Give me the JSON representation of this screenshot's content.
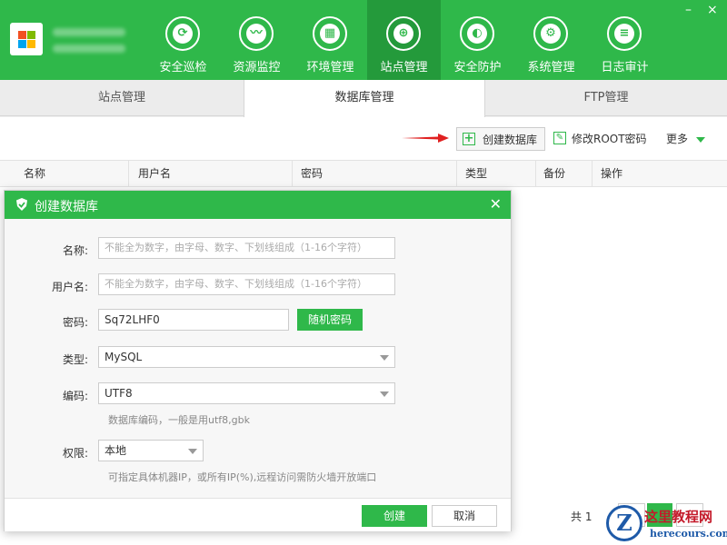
{
  "header": {
    "nav": [
      {
        "label": "安全巡检",
        "icon": "scan-icon",
        "glyph": "⟳"
      },
      {
        "label": "资源监控",
        "icon": "monitor-icon",
        "glyph": "〰"
      },
      {
        "label": "环境管理",
        "icon": "server-icon",
        "glyph": "▦"
      },
      {
        "label": "站点管理",
        "icon": "globe-icon",
        "glyph": "⊕"
      },
      {
        "label": "安全防护",
        "icon": "shield-icon",
        "glyph": "◐"
      },
      {
        "label": "系统管理",
        "icon": "settings-icon",
        "glyph": "⚙"
      },
      {
        "label": "日志审计",
        "icon": "document-icon",
        "glyph": "≡"
      }
    ],
    "active_nav": "站点管理",
    "window_controls": {
      "minimize": "–",
      "close": "×"
    }
  },
  "tabs": [
    {
      "label": "站点管理"
    },
    {
      "label": "数据库管理"
    },
    {
      "label": "FTP管理"
    }
  ],
  "active_tab": "数据库管理",
  "toolbar": {
    "create_db": "创建数据库",
    "modify_root": "修改ROOT密码",
    "more": "更多"
  },
  "table": {
    "columns": [
      "名称",
      "用户名",
      "密码",
      "类型",
      "备份",
      "操作"
    ]
  },
  "pager": {
    "total_prefix": "共 1"
  },
  "dialog": {
    "title": "创建数据库",
    "fields": {
      "name": {
        "label": "名称:",
        "placeholder": "不能全为数字，由字母、数字、下划线组成（1-16个字符）"
      },
      "username": {
        "label": "用户名:",
        "placeholder": "不能全为数字，由字母、数字、下划线组成（1-16个字符）"
      },
      "password": {
        "label": "密码:",
        "value": "Sq72LHF0",
        "random_button": "随机密码"
      },
      "type": {
        "label": "类型:",
        "value": "MySQL"
      },
      "encoding": {
        "label": "编码:",
        "value": "UTF8",
        "hint": "数据库编码，一般是用utf8,gbk"
      },
      "permission": {
        "label": "权限:",
        "value": "本地",
        "hint": "可指定具体机器IP，或所有IP(%),远程访问需防火墙开放端口"
      }
    },
    "buttons": {
      "create": "创建",
      "cancel": "取消"
    }
  },
  "watermark": {
    "logo_letter": "Z",
    "title": "这里教程网",
    "url": "herecours.com"
  },
  "colors": {
    "brand_green": "#2fb84a",
    "active_green": "#249a3b",
    "arrow_red": "#e02020"
  }
}
